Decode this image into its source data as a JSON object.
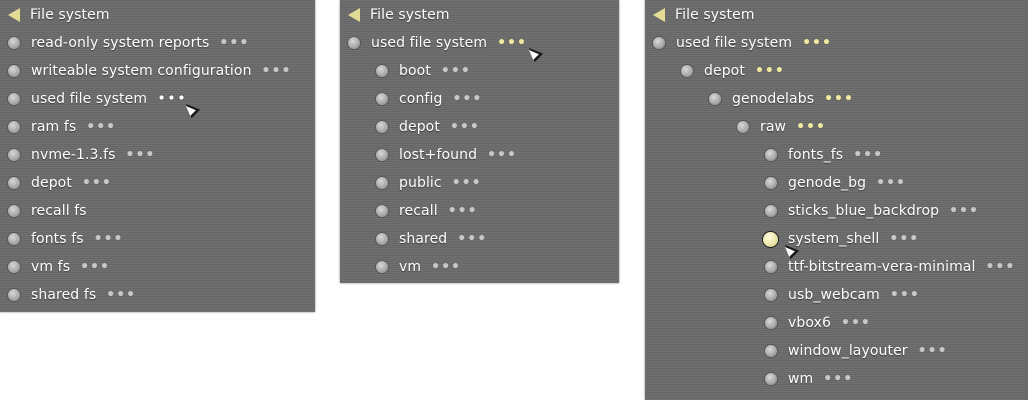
{
  "panel1": {
    "title": "File system",
    "items": [
      {
        "label": "read-only system reports",
        "more": "•••"
      },
      {
        "label": "writeable system configuration",
        "more": "•••"
      },
      {
        "label": "used file system",
        "more": "•••"
      },
      {
        "label": "ram fs",
        "more": "•••"
      },
      {
        "label": "nvme-1.3.fs",
        "more": "•••"
      },
      {
        "label": "depot",
        "more": "•••"
      },
      {
        "label": "recall fs",
        "more": ""
      },
      {
        "label": "fonts fs",
        "more": "•••"
      },
      {
        "label": "vm fs",
        "more": "•••"
      },
      {
        "label": "shared fs",
        "more": "•••"
      }
    ]
  },
  "panel2": {
    "title": "File system",
    "parent": {
      "label": "used file system",
      "more": "•••"
    },
    "items": [
      {
        "label": "boot",
        "more": "•••"
      },
      {
        "label": "config",
        "more": "•••"
      },
      {
        "label": "depot",
        "more": "•••"
      },
      {
        "label": "lost+found",
        "more": "•••"
      },
      {
        "label": "public",
        "more": "•••"
      },
      {
        "label": "recall",
        "more": "•••"
      },
      {
        "label": "shared",
        "more": "•••"
      },
      {
        "label": "vm",
        "more": "•••"
      }
    ]
  },
  "panel3": {
    "title": "File system",
    "path": [
      {
        "label": "used file system",
        "more": "•••"
      },
      {
        "label": "depot",
        "more": "•••"
      },
      {
        "label": "genodelabs",
        "more": "•••"
      },
      {
        "label": "raw",
        "more": "•••"
      }
    ],
    "items": [
      {
        "label": "fonts_fs",
        "more": "•••"
      },
      {
        "label": "genode_bg",
        "more": "•••"
      },
      {
        "label": "sticks_blue_backdrop",
        "more": "•••"
      },
      {
        "label": "system_shell",
        "more": "•••"
      },
      {
        "label": "ttf-bitstream-vera-minimal",
        "more": "•••"
      },
      {
        "label": "usb_webcam",
        "more": "•••"
      },
      {
        "label": "vbox6",
        "more": "•••"
      },
      {
        "label": "window_layouter",
        "more": "•••"
      },
      {
        "label": "wm",
        "more": "•••"
      }
    ]
  },
  "colors": {
    "panel_bg": "#6b6b6b",
    "accent": "#e2dc95",
    "text": "#ffffff"
  }
}
